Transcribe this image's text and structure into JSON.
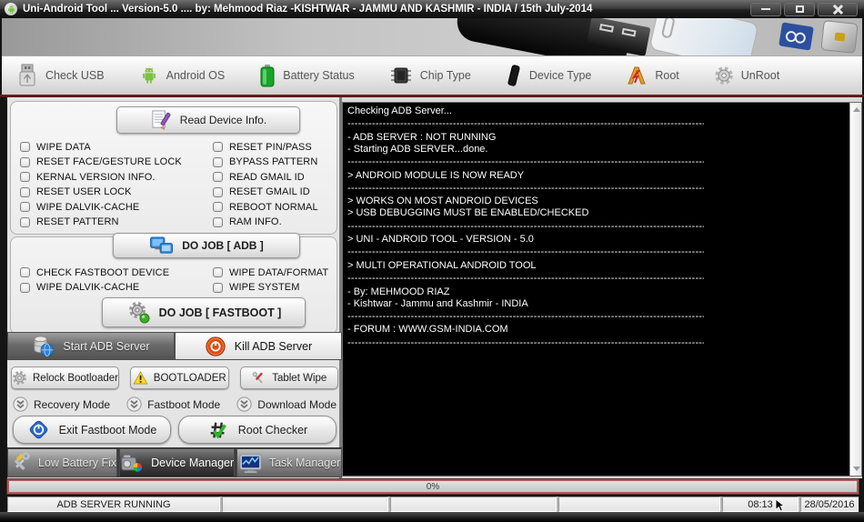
{
  "window": {
    "title": "Uni-Android Tool ... Version-5.0 .... by: Mehmood Riaz -KISHTWAR - JAMMU AND KASHMIR - INDIA   / 15th July-2014"
  },
  "toolbar": {
    "items": [
      {
        "label": "Check USB",
        "icon": "usb-icon"
      },
      {
        "label": "Android OS",
        "icon": "android-icon"
      },
      {
        "label": "Battery Status",
        "icon": "battery-icon"
      },
      {
        "label": "Chip Type",
        "icon": "chip-icon"
      },
      {
        "label": "Device Type",
        "icon": "device-icon"
      },
      {
        "label": "Root",
        "icon": "root-icon"
      },
      {
        "label": "UnRoot",
        "icon": "unroot-gear-icon"
      }
    ]
  },
  "device_info_panel": {
    "read_button": {
      "label": "Read Device Info.",
      "icon": "doc-pencil-icon"
    },
    "checkboxes_left": [
      "WIPE DATA",
      "RESET FACE/GESTURE LOCK",
      "KERNAL VERSION INFO.",
      "RESET USER LOCK",
      "WIPE DALVIK-CACHE",
      "RESET PATTERN"
    ],
    "checkboxes_right": [
      "RESET PIN/PASS",
      "BYPASS PATTERN",
      "READ GMAIL ID",
      "RESET GMAIL ID",
      "REBOOT NORMAL",
      "RAM INFO."
    ],
    "do_job_adb_button": {
      "label": "DO JOB [ ADB ]",
      "icon": "monitors-icon"
    }
  },
  "fastboot_panel": {
    "checkboxes_left": [
      "CHECK FASTBOOT DEVICE",
      "WIPE DALVIK-CACHE"
    ],
    "checkboxes_right": [
      "WIPE DATA/FORMAT",
      "WIPE SYSTEM"
    ],
    "do_job_fastboot_button": {
      "label": "DO JOB [ FASTBOOT ]",
      "icon": "gears-icon"
    }
  },
  "server_buttons": [
    {
      "label": "Start ADB Server",
      "icon": "database-globe-icon",
      "style": "dark"
    },
    {
      "label": "Kill ADB Server",
      "icon": "power-red-icon",
      "style": "light"
    }
  ],
  "bootloader_buttons": [
    {
      "label": "Relock Bootloader",
      "icon": "gear-gray-icon"
    },
    {
      "label": "BOOTLOADER",
      "icon": "warning-icon"
    },
    {
      "label": "Tablet Wipe",
      "icon": "crossed-tools-icon"
    }
  ],
  "mode_buttons": [
    {
      "label": "Recovery Mode",
      "icon": "chevrons-down-icon"
    },
    {
      "label": "Fastboot Mode",
      "icon": "chevrons-down-icon"
    },
    {
      "label": "Download Mode",
      "icon": "chevrons-down-icon"
    }
  ],
  "action_buttons": [
    {
      "label": "Exit Fastboot Mode",
      "icon": "power-blue-icon"
    },
    {
      "label": "Root Checker",
      "icon": "hash-check-icon"
    }
  ],
  "utility_buttons": [
    {
      "label": "Low Battery Fix",
      "icon": "screwdriver-wrench-icon",
      "active": false
    },
    {
      "label": "Device Manager",
      "icon": "device-manager-icon",
      "active": true
    },
    {
      "label": "Task Manager",
      "icon": "task-manager-icon",
      "active": false
    }
  ],
  "console": {
    "lines": [
      "Checking ADB Server...",
      "--------------------------------------------------------------------------------------------------------------",
      "- ADB SERVER : NOT RUNNING",
      "- Starting ADB SERVER...done.",
      "--------------------------------------------------------------------------------------------------------------",
      "> ANDROID MODULE IS NOW READY",
      "--------------------------------------------------------------------------------------------------------------",
      "> WORKS ON MOST ANDROID DEVICES",
      "> USB DEBUGGING MUST BE ENABLED/CHECKED",
      "--------------------------------------------------------------------------------------------------------------",
      "> UNI - ANDROID TOOL - VERSION - 5.0",
      "--------------------------------------------------------------------------------------------------------------",
      "> MULTI OPERATIONAL ANDROID TOOL",
      "--------------------------------------------------------------------------------------------------------------",
      "- By: MEHMOOD RIAZ",
      "- Kishtwar - Jammu and Kashmir - INDIA",
      "--------------------------------------------------------------------------------------------------------------",
      "- FORUM : WWW.GSM-INDIA.COM",
      "--------------------------------------------------------------------------------------------------------------"
    ]
  },
  "progress": {
    "label": "0%"
  },
  "status_bar": {
    "segments": [
      "ADB SERVER RUNNING",
      "",
      "",
      "",
      "08:13",
      "28/05/2016"
    ]
  }
}
